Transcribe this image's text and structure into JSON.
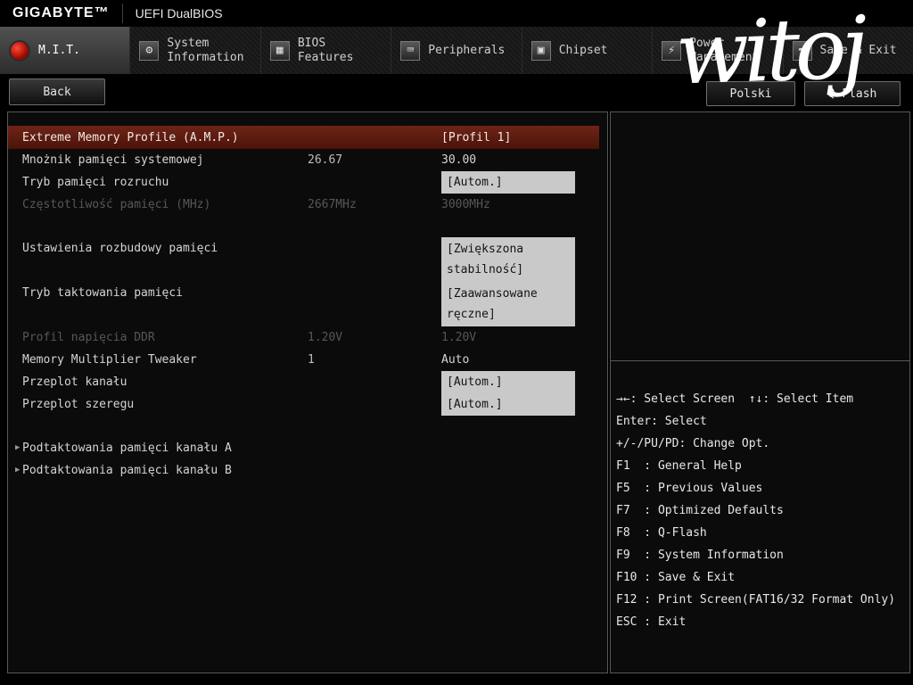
{
  "header": {
    "brand": "GIGABYTE™",
    "title": "UEFI DualBIOS"
  },
  "watermark": {
    "text": "witoj"
  },
  "icons": {
    "system_information": "⚙",
    "bios_features": "▦",
    "peripherals": "⌨",
    "chipset": "▣",
    "power_management": "⚡",
    "save_exit": "➦",
    "submenu_arrow": "▶"
  },
  "tabs": [
    {
      "label": "M.I.T."
    },
    {
      "label": "System Information"
    },
    {
      "label": "BIOS Features"
    },
    {
      "label": "Peripherals"
    },
    {
      "label": "Chipset"
    },
    {
      "label": "Power Management"
    },
    {
      "label": "Save & Exit"
    }
  ],
  "toolbar": {
    "back": "Back",
    "language": "Polski",
    "qflash": "Q-Flash"
  },
  "settings": [
    {
      "label": "Extreme Memory Profile (A.M.P.)",
      "value": "[Profil 1]"
    },
    {
      "label": "Mnożnik pamięci systemowej",
      "mid": "26.67",
      "value": "30.00"
    },
    {
      "label": "Tryb pamięci rozruchu",
      "value": "[Autom.]"
    },
    {
      "label": "Częstotliwość pamięci (MHz)",
      "mid": "2667MHz",
      "value": "3000MHz"
    },
    {
      "label": "Ustawienia rozbudowy pamięci",
      "value": "[Zwiększona stabilność]"
    },
    {
      "label": "Tryb taktowania pamięci",
      "value": "[Zaawansowane ręczne]"
    },
    {
      "label": "Profil napięcia DDR",
      "mid": "1.20V",
      "value": "1.20V"
    },
    {
      "label": "Memory Multiplier Tweaker",
      "mid": "1",
      "value": "Auto"
    },
    {
      "label": "Przeplot kanału",
      "value": "[Autom.]"
    },
    {
      "label": "Przeplot szeregu",
      "value": "[Autom.]"
    },
    {
      "label": "Podtaktowania pamięci kanału A"
    },
    {
      "label": "Podtaktowania pamięci kanału B"
    }
  ],
  "help": {
    "lines": [
      "→←: Select Screen  ↑↓: Select Item",
      "Enter: Select",
      "+/-/PU/PD: Change Opt.",
      "F1  : General Help",
      "F5  : Previous Values",
      "F7  : Optimized Defaults",
      "F8  : Q-Flash",
      "F9  : System Information",
      "F10 : Save & Exit",
      "F12 : Print Screen(FAT16/32 Format Only)",
      "ESC : Exit"
    ]
  }
}
